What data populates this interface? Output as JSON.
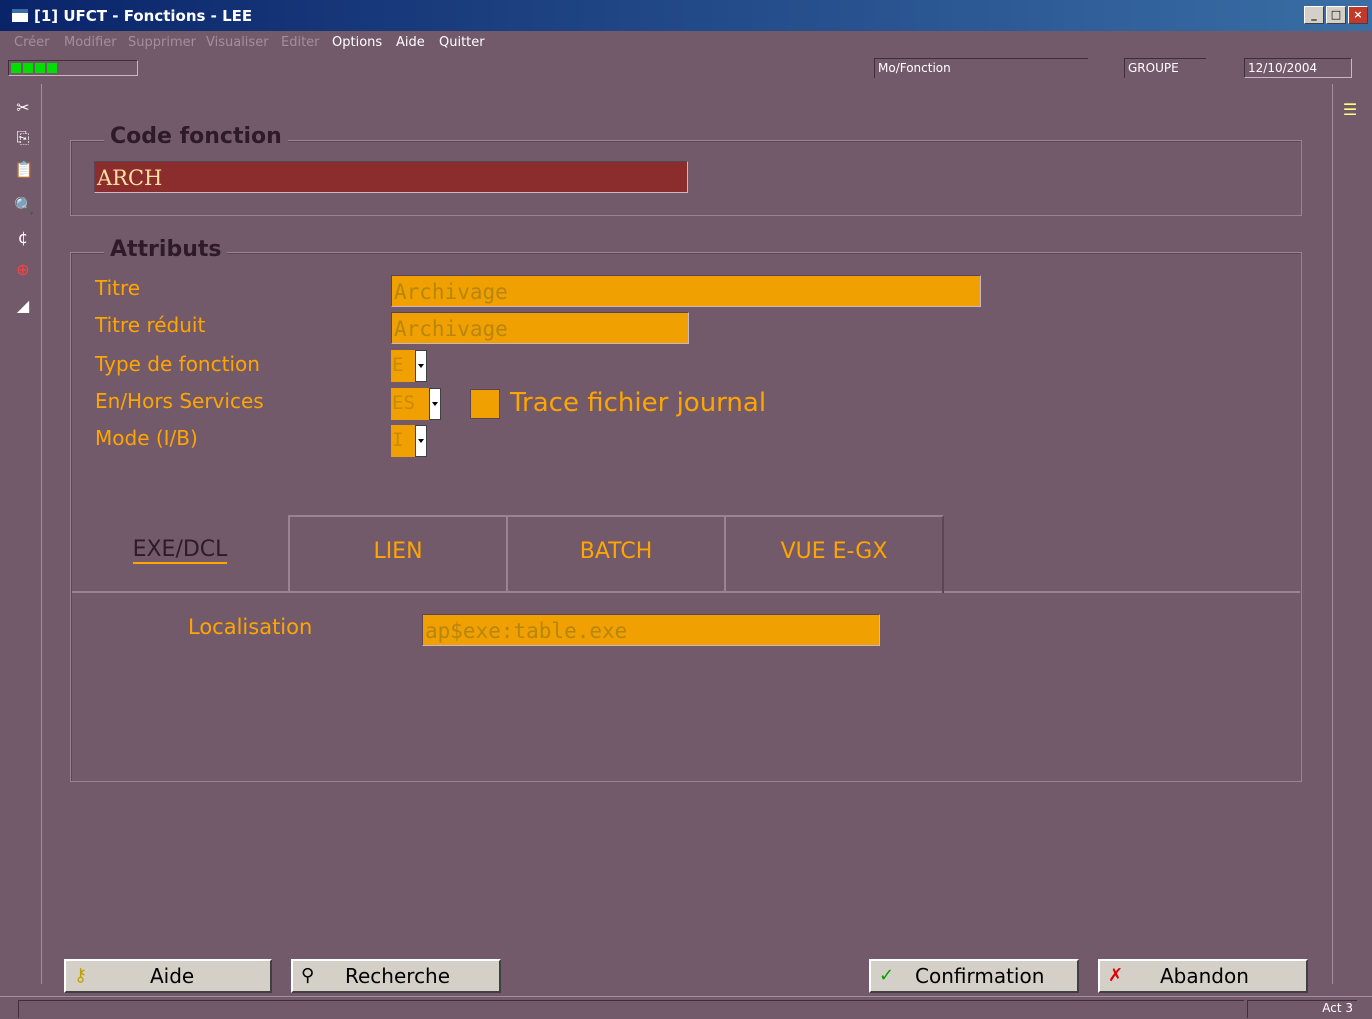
{
  "window": {
    "title": "[1] UFCT - Fonctions - LEE",
    "min_icon": "minimize-icon",
    "max_icon": "maximize-icon",
    "close_icon": "close-icon"
  },
  "menu": {
    "items": [
      {
        "label": "Créer",
        "enabled": false
      },
      {
        "label": "Modifier",
        "enabled": false
      },
      {
        "label": "Supprimer",
        "enabled": false
      },
      {
        "label": "Visualiser",
        "enabled": false
      },
      {
        "label": "Editer",
        "enabled": false
      },
      {
        "label": "Options",
        "enabled": true
      },
      {
        "label": "Aide",
        "enabled": true
      },
      {
        "label": "Quitter",
        "enabled": true
      }
    ]
  },
  "status": {
    "mode": "Mo/Fonction",
    "group": "GROUPE",
    "date": "12/10/2004"
  },
  "code_section": {
    "label": "Code fonction",
    "value": "ARCH"
  },
  "attributes": {
    "label": "Attributs",
    "titre_label": "Titre",
    "titre_value": "Archivage",
    "titre_reduit_label": "Titre réduit",
    "titre_reduit_value": "Archivage",
    "type_label": "Type de fonction",
    "type_value": "E",
    "service_label": "En/Hors Services",
    "service_value": "ES",
    "trace_label": "Trace fichier journal",
    "mode_label": "Mode (I/B)",
    "mode_value": "I"
  },
  "tabs": [
    {
      "label": "EXE/DCL",
      "active": true
    },
    {
      "label": "LIEN",
      "active": false
    },
    {
      "label": "BATCH",
      "active": false
    },
    {
      "label": "VUE E-GX",
      "active": false
    }
  ],
  "exe_tab": {
    "localisation_label": "Localisation",
    "localisation_value": "ap$exe:table.exe"
  },
  "buttons": {
    "aide": "Aide",
    "recherche": "Recherche",
    "confirmation": "Confirmation",
    "abandon": "Abandon"
  },
  "footer": {
    "text": "Act 3"
  }
}
